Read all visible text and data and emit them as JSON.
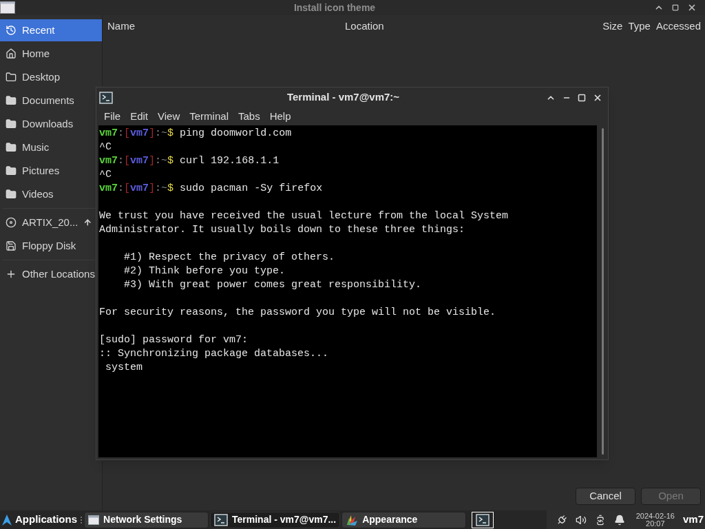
{
  "dialog": {
    "title": "Install icon theme",
    "sidebar": [
      {
        "kind": "recent",
        "label": "Recent",
        "selected": true
      },
      {
        "kind": "home",
        "label": "Home",
        "selected": false
      },
      {
        "kind": "desktop",
        "label": "Desktop",
        "selected": false
      },
      {
        "kind": "folder",
        "label": "Documents",
        "selected": false
      },
      {
        "kind": "folder",
        "label": "Downloads",
        "selected": false
      },
      {
        "kind": "folder",
        "label": "Music",
        "selected": false
      },
      {
        "kind": "folder",
        "label": "Pictures",
        "selected": false
      },
      {
        "kind": "folder",
        "label": "Videos",
        "selected": false
      },
      {
        "kind": "disc",
        "label": "ARTIX_20...",
        "selected": false
      },
      {
        "kind": "floppy",
        "label": "Floppy Disk",
        "selected": false
      },
      {
        "kind": "other",
        "label": "Other Locations",
        "selected": false
      }
    ],
    "columns": [
      "Name",
      "Location",
      "Size",
      "Type",
      "Accessed"
    ],
    "buttons": [
      {
        "label": "Cancel",
        "disabled": false
      },
      {
        "label": "Open",
        "disabled": true
      }
    ]
  },
  "terminal": {
    "title": "Terminal - vm7@vm7:~",
    "menu": [
      "File",
      "Edit",
      "View",
      "Terminal",
      "Tabs",
      "Help"
    ],
    "lines": [
      {
        "kind": "prompt",
        "segments": [
          {
            "text": "vm7",
            "color": "#5ad53a"
          },
          {
            "text": ":",
            "color": "#8a8a8a"
          },
          {
            "text": "[",
            "color": "#a4262c"
          },
          {
            "text": "vm7",
            "color": "#5c5ce0"
          },
          {
            "text": "]",
            "color": "#a4262c"
          },
          {
            "text": ":~",
            "color": "#8a8a8a"
          },
          {
            "text": "$",
            "color": "#e6d84a"
          }
        ],
        "command": "ping doomworld.com"
      },
      {
        "kind": "output",
        "text": "^C"
      },
      {
        "kind": "prompt",
        "segments": [
          {
            "text": "vm7",
            "color": "#5ad53a"
          },
          {
            "text": ":",
            "color": "#8a8a8a"
          },
          {
            "text": "[",
            "color": "#a4262c"
          },
          {
            "text": "vm7",
            "color": "#5c5ce0"
          },
          {
            "text": "]",
            "color": "#a4262c"
          },
          {
            "text": ":~",
            "color": "#8a8a8a"
          },
          {
            "text": "$",
            "color": "#e6d84a"
          }
        ],
        "command": "curl 192.168.1.1"
      },
      {
        "kind": "output",
        "text": "^C"
      },
      {
        "kind": "prompt",
        "segments": [
          {
            "text": "vm7",
            "color": "#5ad53a"
          },
          {
            "text": ":",
            "color": "#8a8a8a"
          },
          {
            "text": "[",
            "color": "#a4262c"
          },
          {
            "text": "vm7",
            "color": "#5c5ce0"
          },
          {
            "text": "]",
            "color": "#a4262c"
          },
          {
            "text": ":~",
            "color": "#8a8a8a"
          },
          {
            "text": "$",
            "color": "#e6d84a"
          }
        ],
        "command": "sudo pacman -Sy firefox"
      },
      {
        "kind": "blank"
      },
      {
        "kind": "output",
        "text": "We trust you have received the usual lecture from the local System"
      },
      {
        "kind": "output",
        "text": "Administrator. It usually boils down to these three things:"
      },
      {
        "kind": "blank"
      },
      {
        "kind": "output",
        "text": "    #1) Respect the privacy of others."
      },
      {
        "kind": "output",
        "text": "    #2) Think before you type."
      },
      {
        "kind": "output",
        "text": "    #3) With great power comes great responsibility."
      },
      {
        "kind": "blank"
      },
      {
        "kind": "output",
        "text": "For security reasons, the password you type will not be visible."
      },
      {
        "kind": "blank"
      },
      {
        "kind": "output",
        "text": "[sudo] password for vm7:"
      },
      {
        "kind": "output",
        "text": ":: Synchronizing package databases..."
      },
      {
        "kind": "output",
        "text": " system"
      }
    ]
  },
  "taskbar": {
    "menu": "Applications",
    "tasks": [
      {
        "kind": "window",
        "label": "Network Settings",
        "selected": false
      },
      {
        "kind": "terminal",
        "label": "Terminal - vm7@vm7...",
        "selected": true
      },
      {
        "kind": "palette",
        "label": "Appearance",
        "selected": false
      }
    ],
    "date": "2024-02-16",
    "time": "20:07",
    "user": "vm7"
  }
}
